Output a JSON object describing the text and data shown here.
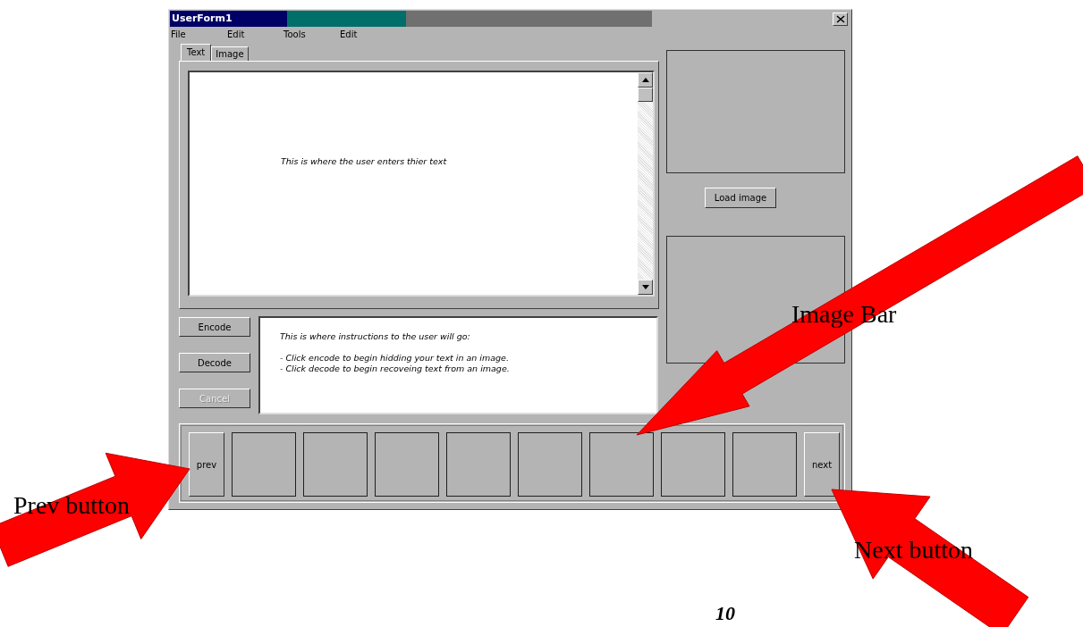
{
  "window": {
    "title": "UserForm1"
  },
  "menu": [
    {
      "label": "File"
    },
    {
      "label": "Edit"
    },
    {
      "label": "Tools"
    },
    {
      "label": "Edit"
    }
  ],
  "tabs": [
    {
      "label": "Text",
      "selected": true
    },
    {
      "label": "Image",
      "selected": false
    }
  ],
  "text_area": {
    "value": "This is where the user enters thier text"
  },
  "load_button": {
    "label": "Load image"
  },
  "buttons": [
    {
      "label": "Encode",
      "disabled": false
    },
    {
      "label": "Decode",
      "disabled": false
    },
    {
      "label": "Cancel",
      "disabled": true
    }
  ],
  "instructions": [
    "This is where instructions to the user will go:",
    "- Click encode to begin hidding your text in an image.",
    "- Click decode to begin recoveing text from an image."
  ],
  "image_bar": {
    "prev": "prev",
    "next": "next",
    "thumbnails": [
      {
        "kind": "empty"
      },
      {
        "kind": "empty"
      },
      {
        "kind": "empty"
      },
      {
        "kind": "empty"
      },
      {
        "kind": "empty"
      },
      {
        "kind": "empty"
      },
      {
        "kind": "empty"
      },
      {
        "kind": "empty"
      }
    ]
  },
  "annotations": [
    {
      "text": "Image Bar"
    },
    {
      "text": "Prev button"
    },
    {
      "text": "Next button"
    }
  ],
  "page_number": "10"
}
